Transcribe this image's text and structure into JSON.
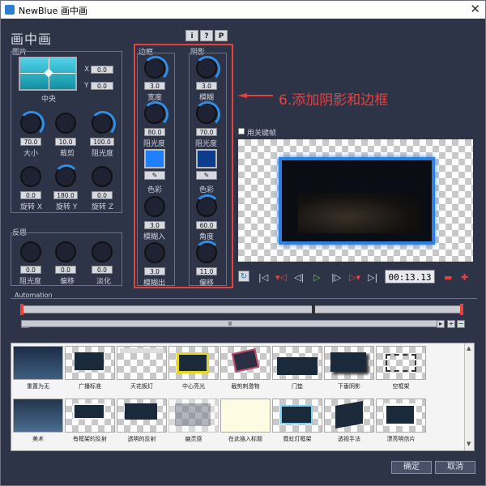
{
  "window": {
    "title": "NewBlue 画中画"
  },
  "heading": "画中画",
  "top_buttons": [
    "i",
    "?",
    "P"
  ],
  "image_section": {
    "label": "图片",
    "x_label": "X",
    "x_value": "0.0",
    "y_label": "Y",
    "y_value": "0.0",
    "preset": "中央",
    "knobs": [
      {
        "value": "70.0",
        "label": "大小"
      },
      {
        "value": "10.0",
        "label": "裁剪"
      },
      {
        "value": "100.0",
        "label": "阻光度"
      },
      {
        "value": "0.0",
        "label": "旋转 X"
      },
      {
        "value": "180.0",
        "label": "旋转 Y"
      },
      {
        "value": "0.0",
        "label": "旋转 Z"
      }
    ]
  },
  "reflection_section": {
    "label": "反思",
    "knobs": [
      {
        "value": "0.0",
        "label": "阻光度"
      },
      {
        "value": "0.0",
        "label": "偏移"
      },
      {
        "value": "0.0",
        "label": "淡化"
      }
    ]
  },
  "border_section": {
    "label": "边框",
    "width_value": "3.0",
    "width_label": "宽度",
    "opacity_value": "80.0",
    "opacity_label": "阻光度",
    "color_label": "色彩",
    "color": "#1e7fff",
    "blur_in_value": "3.0",
    "blur_in_label": "模糊入",
    "blur_out_value": "3.0",
    "blur_out_label": "模糊出"
  },
  "shadow_section": {
    "label": "阴影",
    "blur_value": "3.0",
    "blur_label": "模糊",
    "opacity_value": "70.0",
    "opacity_label": "阻光度",
    "color_label": "色彩",
    "color": "#0b3d8c",
    "angle_value": "60.0",
    "angle_label": "角度",
    "offset_value": "11.0",
    "offset_label": "偏移"
  },
  "annotation": "6.添加阴影和边框",
  "keyframe_checkbox": "用关键帧",
  "transport": {
    "timecode": "00:13.13"
  },
  "automation_label": "Automation",
  "presets": [
    "重置为无",
    "广播标准",
    "天花板灯",
    "中心亮光",
    "截剪刺激物",
    "门垫",
    "下垂阴影",
    "空框架",
    "美术",
    "有框架的反射",
    "透明的反射",
    "幽灵感",
    "在此插入标题",
    "霓虹灯框架",
    "透视手法",
    "漂亮明信片"
  ],
  "buttons": {
    "ok": "确定",
    "cancel": "取消"
  }
}
